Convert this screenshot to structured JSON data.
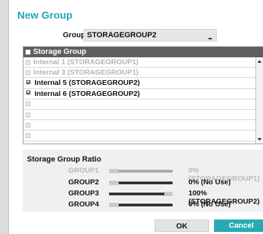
{
  "dialog": {
    "title": "New Group",
    "group_label": "Group",
    "group_value": "STORAGEGROUP2"
  },
  "storage_list": {
    "header": "Storage Group",
    "items": [
      {
        "label": "Internal 1 (STORAGEGROUP1)",
        "checked": false,
        "enabled": false
      },
      {
        "label": "Internal 3 (STORAGEGROUP1)",
        "checked": false,
        "enabled": false
      },
      {
        "label": "Internal 5 (STORAGEGROUP2)",
        "checked": true,
        "enabled": true
      },
      {
        "label": "Internal 6 (STORAGEGROUP2)",
        "checked": true,
        "enabled": true
      },
      {
        "label": "",
        "checked": false,
        "enabled": false
      },
      {
        "label": "",
        "checked": false,
        "enabled": false
      },
      {
        "label": "",
        "checked": false,
        "enabled": false
      },
      {
        "label": "",
        "checked": false,
        "enabled": false
      }
    ]
  },
  "ratio": {
    "title": "Storage Group Ratio",
    "rows": [
      {
        "name": "GROUP1",
        "value_text": "0% (STORAGEGROUP1)",
        "percent": 0,
        "enabled": false
      },
      {
        "name": "GROUP2",
        "value_text": "0% (No Use)",
        "percent": 0,
        "enabled": true
      },
      {
        "name": "GROUP3",
        "value_text": "100% (STORAGEGROUP2)",
        "percent": 100,
        "enabled": true
      },
      {
        "name": "GROUP4",
        "value_text": "0% (No Use)",
        "percent": 0,
        "enabled": true
      }
    ]
  },
  "buttons": {
    "ok": "OK",
    "cancel": "Cancel"
  },
  "colors": {
    "accent": "#27aab3",
    "title": "#27a8b6",
    "bar_fill_enabled": "#333333",
    "bar_fill_disabled": "#a8a8a8"
  }
}
